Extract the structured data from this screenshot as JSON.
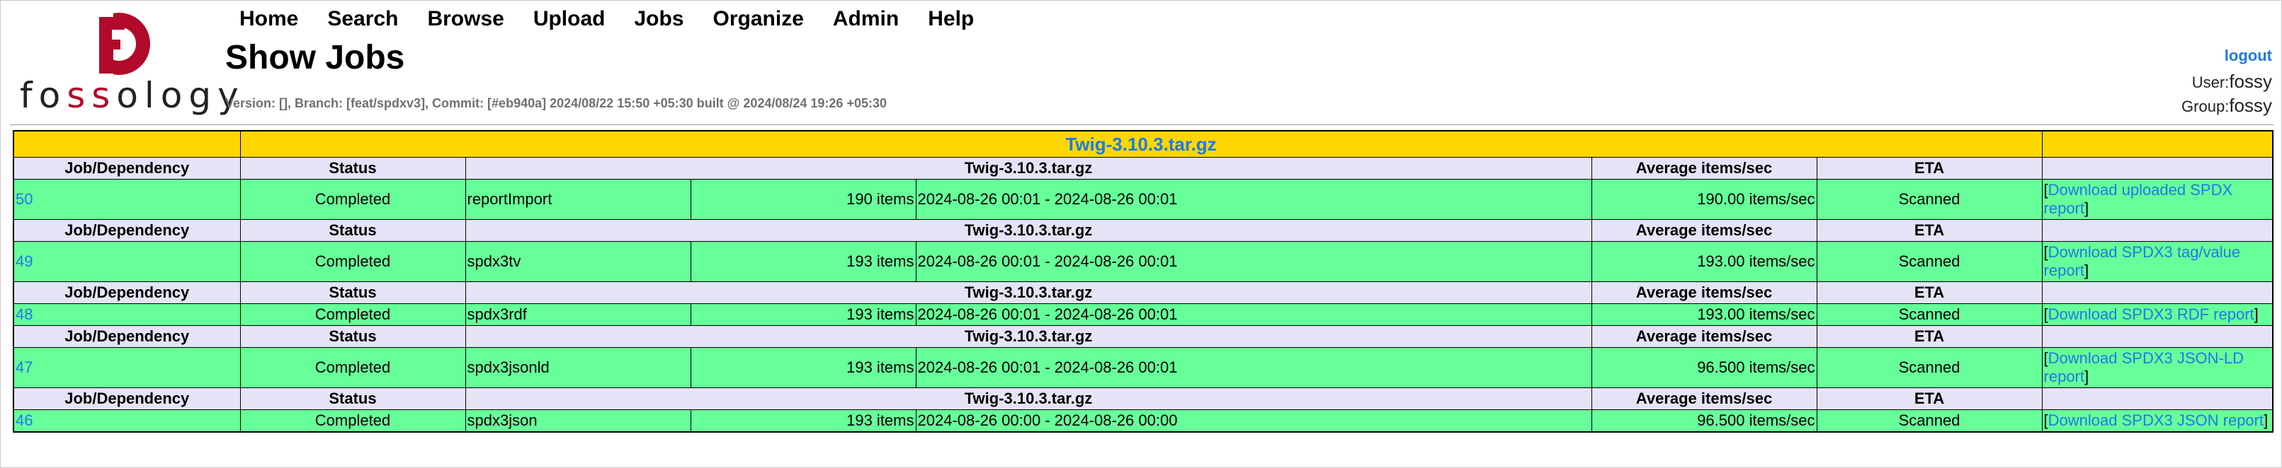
{
  "header": {
    "logo_text": [
      "f",
      "o",
      "s",
      "s",
      "ology"
    ],
    "menu": [
      "Home",
      "Search",
      "Browse",
      "Upload",
      "Jobs",
      "Organize",
      "Admin",
      "Help"
    ],
    "page_title": "Show Jobs",
    "version": "Version: [], Branch: [feat/spdxv3], Commit: [#eb940a] 2024/08/22 15:50 +05:30 built @ 2024/08/24 19:26 +05:30",
    "logout": "logout",
    "user_label": "User:",
    "user": "fossy",
    "group_label": "Group:",
    "group": "fossy"
  },
  "table": {
    "upload_name": "Twig-3.10.3.tar.gz",
    "headers": {
      "job": "Job/Dependency",
      "status": "Status",
      "upload": "Twig-3.10.3.tar.gz",
      "avg": "Average items/sec",
      "eta": "ETA"
    },
    "jobs": [
      {
        "id": "50",
        "status": "Completed",
        "agent": "reportImport",
        "items": "190 items",
        "time": "2024-08-26 00:01 - 2024-08-26 00:01",
        "avg": "190.00 items/sec",
        "eta": "Scanned",
        "action": "Download uploaded SPDX report"
      },
      {
        "id": "49",
        "status": "Completed",
        "agent": "spdx3tv",
        "items": "193 items",
        "time": "2024-08-26 00:01 - 2024-08-26 00:01",
        "avg": "193.00 items/sec",
        "eta": "Scanned",
        "action": "Download SPDX3 tag/value report"
      },
      {
        "id": "48",
        "status": "Completed",
        "agent": "spdx3rdf",
        "items": "193 items",
        "time": "2024-08-26 00:01 - 2024-08-26 00:01",
        "avg": "193.00 items/sec",
        "eta": "Scanned",
        "action": "Download SPDX3 RDF report"
      },
      {
        "id": "47",
        "status": "Completed",
        "agent": "spdx3jsonld",
        "items": "193 items",
        "time": "2024-08-26 00:01 - 2024-08-26 00:01",
        "avg": "96.500 items/sec",
        "eta": "Scanned",
        "action": "Download SPDX3 JSON-LD report"
      },
      {
        "id": "46",
        "status": "Completed",
        "agent": "spdx3json",
        "items": "193 items",
        "time": "2024-08-26 00:00 - 2024-08-26 00:00",
        "avg": "96.500 items/sec",
        "eta": "Scanned",
        "action": "Download SPDX3 JSON report"
      }
    ]
  },
  "colors": {
    "link": "#1e7ae6",
    "upload_row": "#ffd700",
    "header_row": "#e4e4f6",
    "completed_row": "#66ff99",
    "logo_red": "#b10a2a"
  }
}
